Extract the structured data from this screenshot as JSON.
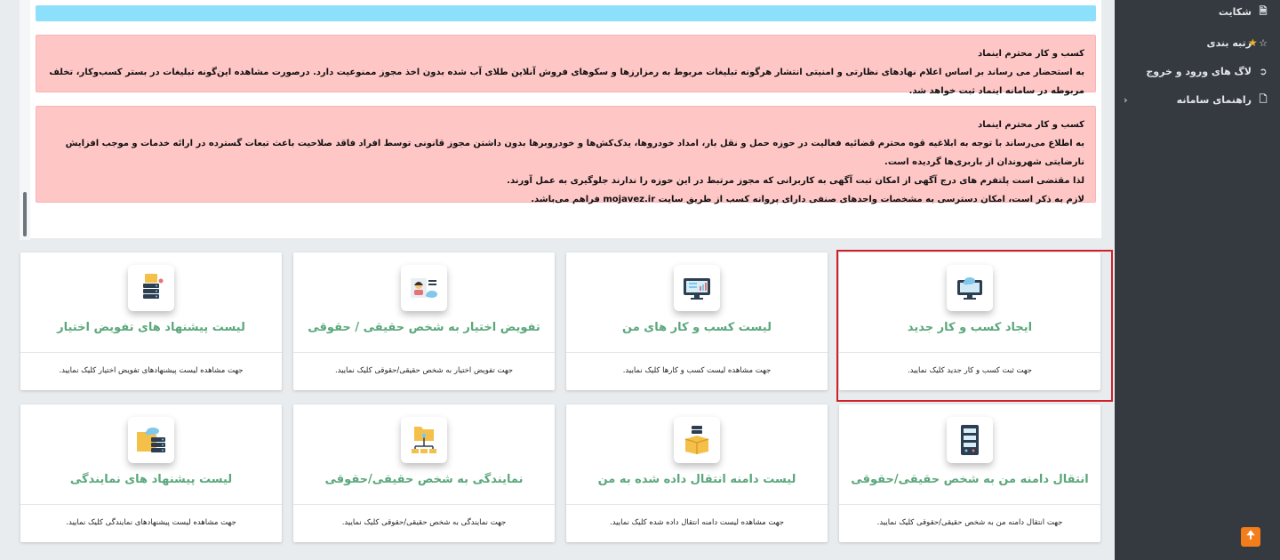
{
  "sidebar": {
    "items": [
      {
        "icon": "file-icon",
        "label": "شکایت"
      },
      {
        "icon": "star-outline-icon",
        "label": "رتبه بندی"
      },
      {
        "icon": "login-icon",
        "label": "لاگ های ورود و خروج"
      },
      {
        "icon": "file-icon",
        "label": "راهنمای سامانه"
      }
    ]
  },
  "alerts": [
    {
      "title": "کسب و کار محترم اینماد",
      "lines": [
        "به استحضار می رساند بر اساس اعلام نهادهای نظارتی و امنیتی انتشار هرگونه تبلیغات مربوط به رمزارزها و سکوهای فروش آنلاین طلای آب شده بدون اخذ مجوز ممنوعیت دارد. درصورت مشاهده این‌گونه تبلیغات در بستر کسب‌وکار، تخلف مربوطه در سامانه اینماد ثبت خواهد شد."
      ]
    },
    {
      "title": "کسب و کار محترم اینماد",
      "lines": [
        "به اطلاع می‌رساند با توجه به ابلاغیه قوه محترم قضائیه فعالیت در حوزه حمل و نقل بار، امداد خودروها، یدک‌کش‌ها و خودروبرها بدون داشتن مجوز قانونی توسط افراد فاقد صلاحیت باعث تبعات گسترده در ارائه خدمات و موجب افزایش نارضایتی شهروندان از باربری‌ها گردیده است.",
        "لذا مقتضی است پلتفرم های درج آگهی از امکان ثبت آگهی به کاربرانی که مجوز مرتبط در این حوزه را ندارند جلوگیری به عمل آورند.",
        "لازم به ذکر است، امکان دسترسی به مشخصات واحدهای صنفی دارای پروانه کسب از طریق سایت mojavez.ir فراهم می‌باشد."
      ]
    }
  ],
  "cards": [
    {
      "title": "ایجاد کسب و کار جدید",
      "desc": "جهت ثبت کسب و کار جدید کلیک نمایید.",
      "icon": "monitor-cloud-icon"
    },
    {
      "title": "لیست کسب و کار های من",
      "desc": "جهت مشاهده لیست کسب و کارها کلیک نمایید.",
      "icon": "monitor-chart-icon"
    },
    {
      "title": "تفویض اختیار به شخص حقیقی / حقوقی",
      "desc": "جهت تفویض اختیار به شخص حقیقی/حقوقی کلیک نمایید.",
      "icon": "person-cloud-icon"
    },
    {
      "title": "لیست پیشنهاد های تفویض اختیار",
      "desc": "جهت مشاهده لیست پیشنهادهای تفویض اختیار کلیک نمایید.",
      "icon": "server-folder-icon"
    },
    {
      "title": "انتقال دامنه من به شخص حقیقی/حقوقی",
      "desc": "جهت انتقال دامنه من به شخص حقیقی/حقوقی کلیک نمایید.",
      "icon": "server-rack-icon"
    },
    {
      "title": "لیست دامنه انتقال داده شده به من",
      "desc": "جهت مشاهده لیست دامنه انتقال داده شده کلیک نمایید.",
      "icon": "box-server-icon"
    },
    {
      "title": "نمایندگی به شخص حقیقی/حقوقی",
      "desc": "جهت نمایندگی به شخص حقیقی/حقوقی کلیک نمایید.",
      "icon": "folder-network-icon"
    },
    {
      "title": "لیست پیشنهاد های نمایندگی",
      "desc": "جهت مشاهده لیست پیشنهادهای نمایندگی کلیک نمایید.",
      "icon": "folder-cloud-server-icon"
    }
  ]
}
